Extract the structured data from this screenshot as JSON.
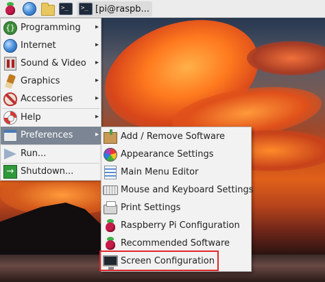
{
  "taskbar": {
    "task_label": "[pi@raspb...",
    "icons": [
      "raspberry-menu-icon",
      "globe-browser-icon",
      "folder-icon",
      "terminal-icon",
      "terminal-icon"
    ]
  },
  "main_menu": {
    "items": [
      {
        "label": "Programming",
        "icon": "programming-icon",
        "has_submenu": true
      },
      {
        "label": "Internet",
        "icon": "globe-icon",
        "has_submenu": true
      },
      {
        "label": "Sound & Video",
        "icon": "sound-video-icon",
        "has_submenu": true
      },
      {
        "label": "Graphics",
        "icon": "paintbrush-icon",
        "has_submenu": true
      },
      {
        "label": "Accessories",
        "icon": "accessories-icon",
        "has_submenu": true
      },
      {
        "label": "Help",
        "icon": "lifebuoy-help-icon",
        "has_submenu": true
      },
      {
        "label": "Preferences",
        "icon": "preferences-icon",
        "has_submenu": true,
        "selected": true
      },
      {
        "label": "Run...",
        "icon": "run-arrow-icon",
        "has_submenu": false
      },
      {
        "label": "Shutdown...",
        "icon": "shutdown-icon",
        "has_submenu": false
      }
    ],
    "arrow_glyph": "▸"
  },
  "submenu": {
    "items": [
      {
        "label": "Add / Remove Software",
        "icon": "package-icon"
      },
      {
        "label": "Appearance Settings",
        "icon": "color-wheel-icon"
      },
      {
        "label": "Main Menu Editor",
        "icon": "menu-editor-icon"
      },
      {
        "label": "Mouse and Keyboard Settings",
        "icon": "keyboard-icon"
      },
      {
        "label": "Print Settings",
        "icon": "printer-icon"
      },
      {
        "label": "Raspberry Pi Configuration",
        "icon": "raspberry-icon"
      },
      {
        "label": "Recommended Software",
        "icon": "raspberry-icon"
      },
      {
        "label": "Screen Configuration",
        "icon": "monitor-icon",
        "highlighted": true
      }
    ]
  },
  "colors": {
    "menu_bg": "#f2f2f2",
    "selected_bg": "#7b8593",
    "highlight_border": "#e0262a",
    "raspberry": "#c51a4a"
  }
}
